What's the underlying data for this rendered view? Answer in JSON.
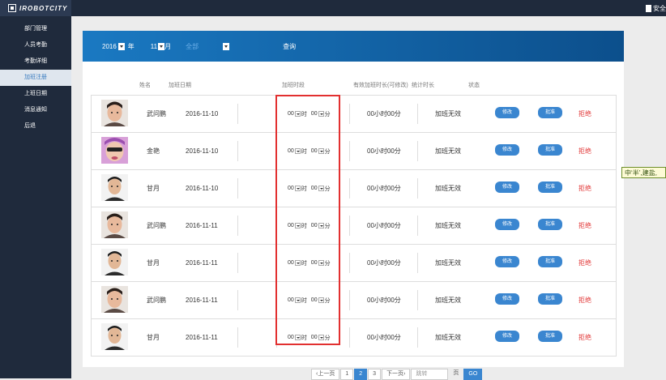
{
  "header": {
    "logo_text": "IROBOTCITY",
    "logout_label": "安全"
  },
  "sidebar": {
    "items": [
      {
        "label": "部门管理"
      },
      {
        "label": "人员考勤"
      },
      {
        "label": "考勤详细"
      },
      {
        "label": "加班注册"
      },
      {
        "label": "上班日期"
      },
      {
        "label": "消息通知"
      },
      {
        "label": "后退"
      }
    ],
    "active_index": 3
  },
  "filter": {
    "year": "2016",
    "year_unit": "年",
    "month": "11",
    "month_unit": "月",
    "dept": "全部",
    "search_label": "查询"
  },
  "columns": {
    "name": "姓名",
    "date": "加班日期",
    "period": "加班时段",
    "valid": "有效加班时长(可修改)",
    "stat": "统计时长",
    "status": "状态"
  },
  "rows": [
    {
      "name": "武问鹏",
      "date": "2016-11-10",
      "hour": "00",
      "hour_unit": "时",
      "minute": "00",
      "minute_unit": "分",
      "valid": "00小时00分",
      "stat": "加班无效",
      "edit": "修改",
      "approve": "批准",
      "reject": "拒绝",
      "avatar": "male-a"
    },
    {
      "name": "金艳",
      "date": "2016-11-10",
      "hour": "00",
      "hour_unit": "时",
      "minute": "00",
      "minute_unit": "分",
      "valid": "00小时00分",
      "stat": "加班无效",
      "edit": "修改",
      "approve": "批准",
      "reject": "拒绝",
      "avatar": "female-a"
    },
    {
      "name": "甘月",
      "date": "2016-11-10",
      "hour": "00",
      "hour_unit": "时",
      "minute": "00",
      "minute_unit": "分",
      "valid": "00小时00分",
      "stat": "加班无效",
      "edit": "修改",
      "approve": "批准",
      "reject": "拒绝",
      "avatar": "male-b"
    },
    {
      "name": "武问鹏",
      "date": "2016-11-11",
      "hour": "00",
      "hour_unit": "时",
      "minute": "00",
      "minute_unit": "分",
      "valid": "00小时00分",
      "stat": "加班无效",
      "edit": "修改",
      "approve": "批准",
      "reject": "拒绝",
      "avatar": "male-a"
    },
    {
      "name": "甘月",
      "date": "2016-11-11",
      "hour": "00",
      "hour_unit": "时",
      "minute": "00",
      "minute_unit": "分",
      "valid": "00小时00分",
      "stat": "加班无效",
      "edit": "修改",
      "approve": "批准",
      "reject": "拒绝",
      "avatar": "male-b"
    },
    {
      "name": "武问鹏",
      "date": "2016-11-11",
      "hour": "00",
      "hour_unit": "时",
      "minute": "00",
      "minute_unit": "分",
      "valid": "00小时00分",
      "stat": "加班无效",
      "edit": "修改",
      "approve": "批准",
      "reject": "拒绝",
      "avatar": "male-a"
    },
    {
      "name": "甘月",
      "date": "2016-11-11",
      "hour": "00",
      "hour_unit": "时",
      "minute": "00",
      "minute_unit": "分",
      "valid": "00小时00分",
      "stat": "加班无效",
      "edit": "修改",
      "approve": "批准",
      "reject": "拒绝",
      "avatar": "male-b"
    }
  ],
  "pager": {
    "prev": "‹上一页",
    "pages": [
      "1",
      "2",
      "3"
    ],
    "current": "2",
    "next": "下一页›",
    "jump_placeholder": "跳转",
    "page_unit": "页",
    "go": "GO"
  },
  "overlay_text": "中‘半’,建盐,",
  "colors": {
    "topbar": "#1f2a3c",
    "banner_start": "#1a79c2",
    "banner_end": "#0c4f8c",
    "button": "#3a86d0",
    "reject": "#e23a3a",
    "highlight_box": "#e23030"
  }
}
